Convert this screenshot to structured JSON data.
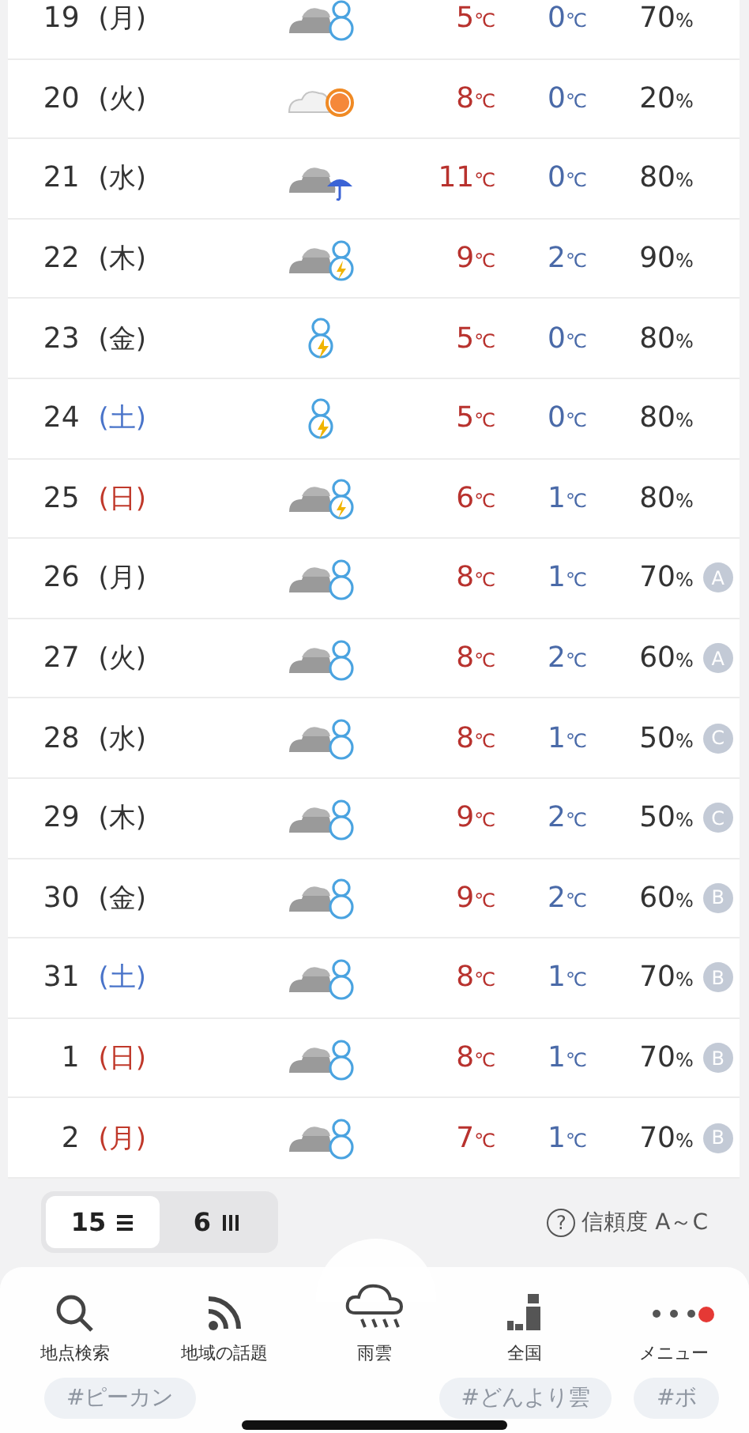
{
  "days": [
    {
      "date": "19",
      "weekday": "(月)",
      "color": "#333333",
      "kind": "snowcloud",
      "high": "5",
      "low": "0",
      "pop": "70"
    },
    {
      "date": "20",
      "weekday": "(火)",
      "color": "#333333",
      "kind": "suncloud",
      "high": "8",
      "low": "0",
      "pop": "20"
    },
    {
      "date": "21",
      "weekday": "(水)",
      "color": "#333333",
      "kind": "raincloud",
      "high": "11",
      "low": "0",
      "pop": "80"
    },
    {
      "date": "22",
      "weekday": "(木)",
      "color": "#333333",
      "kind": "stormcloud",
      "high": "9",
      "low": "2",
      "pop": "90"
    },
    {
      "date": "23",
      "weekday": "(金)",
      "color": "#333333",
      "kind": "stormsnow",
      "high": "5",
      "low": "0",
      "pop": "80"
    },
    {
      "date": "24",
      "weekday": "(土)",
      "color": "#4a74c9",
      "kind": "stormsnow",
      "high": "5",
      "low": "0",
      "pop": "80"
    },
    {
      "date": "25",
      "weekday": "(日)",
      "color": "#c0392b",
      "kind": "stormcloud",
      "high": "6",
      "low": "1",
      "pop": "80"
    },
    {
      "date": "26",
      "weekday": "(月)",
      "color": "#333333",
      "kind": "snowcloud",
      "high": "8",
      "low": "1",
      "pop": "70",
      "reliability": "A"
    },
    {
      "date": "27",
      "weekday": "(火)",
      "color": "#333333",
      "kind": "snowcloud",
      "high": "8",
      "low": "2",
      "pop": "60",
      "reliability": "A"
    },
    {
      "date": "28",
      "weekday": "(水)",
      "color": "#333333",
      "kind": "snowcloud",
      "high": "8",
      "low": "1",
      "pop": "50",
      "reliability": "C"
    },
    {
      "date": "29",
      "weekday": "(木)",
      "color": "#333333",
      "kind": "snowcloud",
      "high": "9",
      "low": "2",
      "pop": "50",
      "reliability": "C"
    },
    {
      "date": "30",
      "weekday": "(金)",
      "color": "#333333",
      "kind": "snowcloud",
      "high": "9",
      "low": "2",
      "pop": "60",
      "reliability": "B"
    },
    {
      "date": "31",
      "weekday": "(土)",
      "color": "#4a74c9",
      "kind": "snowcloud",
      "high": "8",
      "low": "1",
      "pop": "70",
      "reliability": "B"
    },
    {
      "date": "1",
      "weekday": "(日)",
      "color": "#c0392b",
      "kind": "snowcloud",
      "high": "8",
      "low": "1",
      "pop": "70",
      "reliability": "B"
    },
    {
      "date": "2",
      "weekday": "(月)",
      "color": "#c0392b",
      "kind": "snowcloud",
      "high": "7",
      "low": "1",
      "pop": "70",
      "reliability": "B"
    }
  ],
  "temp_unit": "℃",
  "pop_unit": "%",
  "view_toggle": [
    {
      "label": "15",
      "selected": true,
      "kind": "list"
    },
    {
      "label": "6",
      "selected": false,
      "kind": "columns"
    }
  ],
  "reliability_help": {
    "icon": "?",
    "label": "信頼度 A～C"
  },
  "nav": [
    {
      "label": "地点検索",
      "kind": "search"
    },
    {
      "label": "地域の話題",
      "kind": "feed"
    },
    {
      "label": "雨雲",
      "kind": "rain"
    },
    {
      "label": "全国",
      "kind": "map"
    },
    {
      "label": "メニュー",
      "kind": "menu",
      "notification": true
    }
  ],
  "tags": [
    "#ピーカン",
    "#どんより雲",
    "#ボ"
  ]
}
